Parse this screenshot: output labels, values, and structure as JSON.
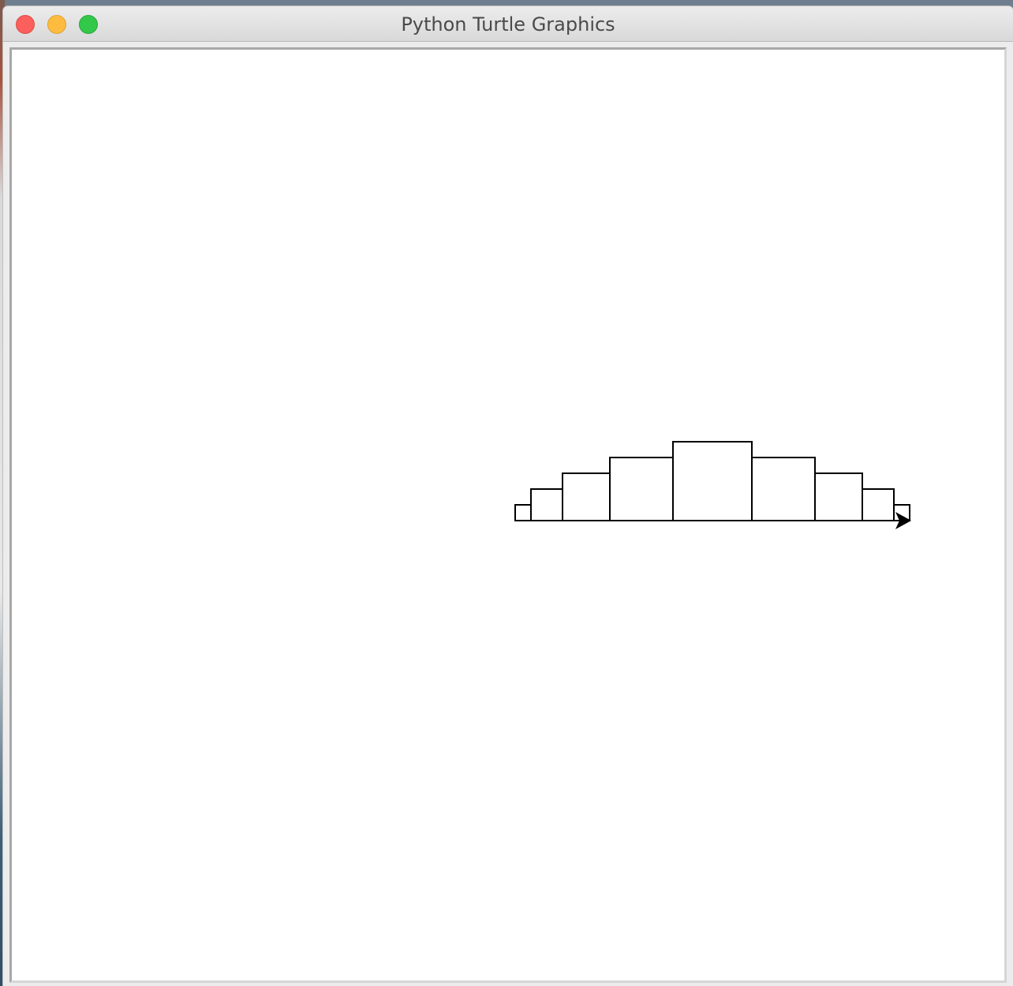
{
  "window": {
    "title": "Python Turtle Graphics"
  },
  "colors": {
    "close": "#fc605c",
    "minimize": "#fdbc40",
    "maximize": "#34c84a",
    "canvas": "#ffffff",
    "pen": "#000000"
  },
  "drawing": {
    "description_type": "turtle-histogram",
    "bar_heights": [
      1,
      2,
      3,
      4,
      5,
      4,
      3,
      2,
      1
    ],
    "bar_widths": [
      1,
      2,
      3,
      4,
      5,
      4,
      3,
      2,
      1
    ],
    "turtle_shape": "classic-arrow",
    "turtle_heading": "east"
  }
}
